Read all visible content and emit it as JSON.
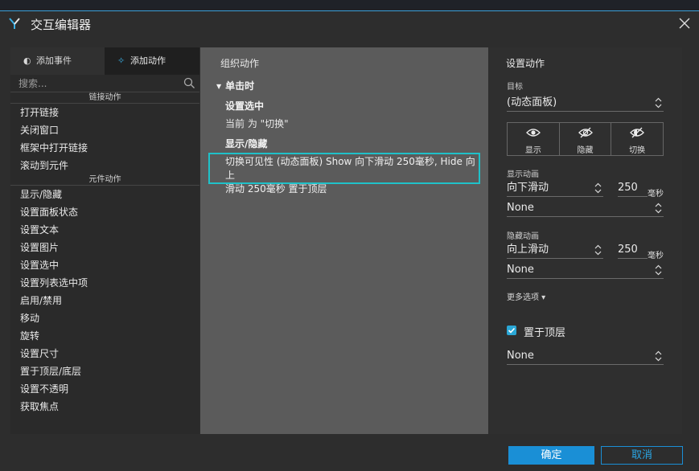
{
  "window": {
    "title": "交互编辑器"
  },
  "left": {
    "tabs": [
      {
        "label": "添加事件"
      },
      {
        "label": "添加动作"
      }
    ],
    "search": {
      "placeholder": "搜索..."
    },
    "sections": [
      {
        "title": "链接动作",
        "items": [
          "打开链接",
          "关闭窗口",
          "框架中打开链接",
          "滚动到元件"
        ]
      },
      {
        "title": "元件动作",
        "items": [
          "显示/隐藏",
          "设置面板状态",
          "设置文本",
          "设置图片",
          "设置选中",
          "设置列表选中项",
          "启用/禁用",
          "移动",
          "旋转",
          "设置尺寸",
          "置于顶层/底层",
          "设置不透明",
          "获取焦点"
        ]
      }
    ]
  },
  "middle": {
    "header": "组织动作",
    "event": "单击时",
    "actions": [
      {
        "title": "设置选中",
        "desc": "当前 为 \"切换\""
      },
      {
        "title": "显示/隐藏",
        "desc_line1": "切换可见性 (动态面板) Show 向下滑动 250毫秒, Hide 向上",
        "desc_line2": "滑动 250毫秒 置于顶层"
      }
    ]
  },
  "right": {
    "header": "设置动作",
    "target_label": "目标",
    "target_value": "(动态面板)",
    "visibility": [
      {
        "label": "显示",
        "icon": "eye-icon"
      },
      {
        "label": "隐藏",
        "icon": "eye-off-icon"
      },
      {
        "label": "切换",
        "icon": "eye-toggle-icon"
      }
    ],
    "show_anim": {
      "label": "显示动画",
      "type": "向下滑动",
      "duration": "250",
      "unit": "毫秒",
      "easing": "None"
    },
    "hide_anim": {
      "label": "隐藏动画",
      "type": "向上滑动",
      "duration": "250",
      "unit": "毫秒",
      "easing": "None"
    },
    "more_options": "更多选项 ▾",
    "bring_to_front": {
      "label": "置于顶层",
      "checked": true
    },
    "bottom_select": "None"
  },
  "footer": {
    "ok": "确定",
    "cancel": "取消"
  },
  "colors": {
    "accent": "#1a8fd6",
    "selection": "#1fc1c9",
    "checkbox": "#2aa7d6"
  }
}
